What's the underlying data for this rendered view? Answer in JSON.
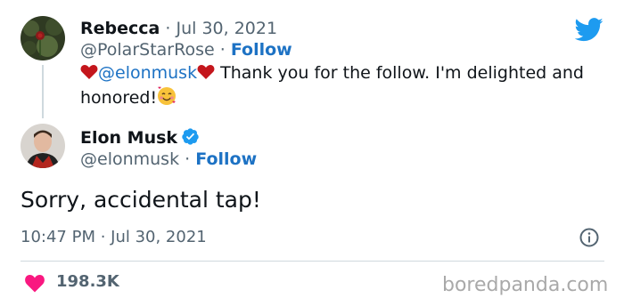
{
  "reply_tweet": {
    "author_name": "Rebecca",
    "separator": "·",
    "date": "Jul 30, 2021",
    "handle": "@PolarStarRose",
    "follow_label": "Follow",
    "mention": "@elonmusk",
    "body": " Thank you for the follow.  I'm delighted and honored!",
    "emoji": "🥰"
  },
  "main_tweet": {
    "author_name": "Elon Musk",
    "handle": "@elonmusk",
    "separator": "·",
    "follow_label": "Follow",
    "text": "Sorry, accidental tap!",
    "timestamp": "10:47 PM · Jul 30, 2021",
    "like_count": "198.3K"
  },
  "watermark": "boredpanda.com",
  "colors": {
    "twitter_blue": "#1d9bf0",
    "like_red": "#f91880",
    "heart_red": "#c4161c",
    "verified_blue": "#1d9bf0"
  },
  "icons": [
    "twitter-bird-icon",
    "verified-badge-icon",
    "heart-icon",
    "info-icon",
    "red-heart-emoji-icon",
    "smiling-face-with-hearts-emoji-icon"
  ]
}
